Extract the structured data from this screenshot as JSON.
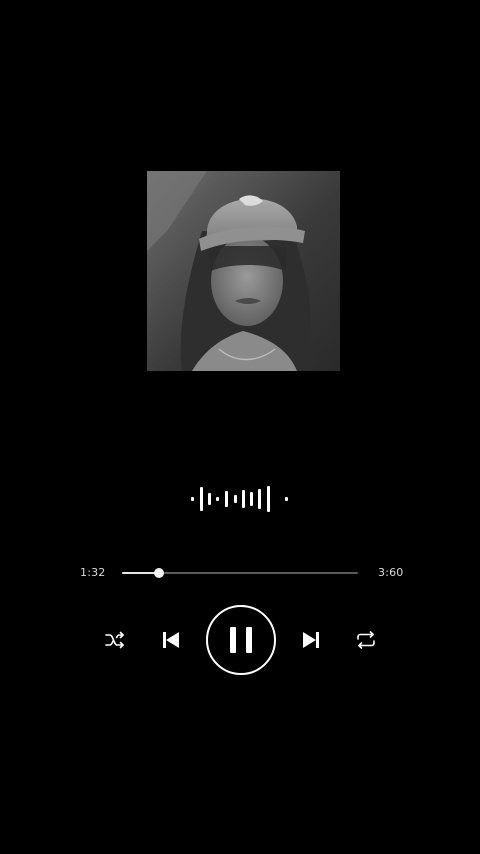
{
  "player": {
    "elapsed": "1:32",
    "total": "3:60",
    "progress_fraction": 0.157,
    "state": "playing"
  },
  "icons": {
    "cover": "album-art-image",
    "waveform": "sound-wave-icon",
    "shuffle": "shuffle-icon",
    "previous": "skip-previous-icon",
    "play_pause": "pause-icon",
    "next": "skip-next-icon",
    "repeat": "repeat-icon"
  },
  "colors": {
    "background": "#000000",
    "foreground": "#f2f2f2",
    "track": "#5a5a5a"
  }
}
